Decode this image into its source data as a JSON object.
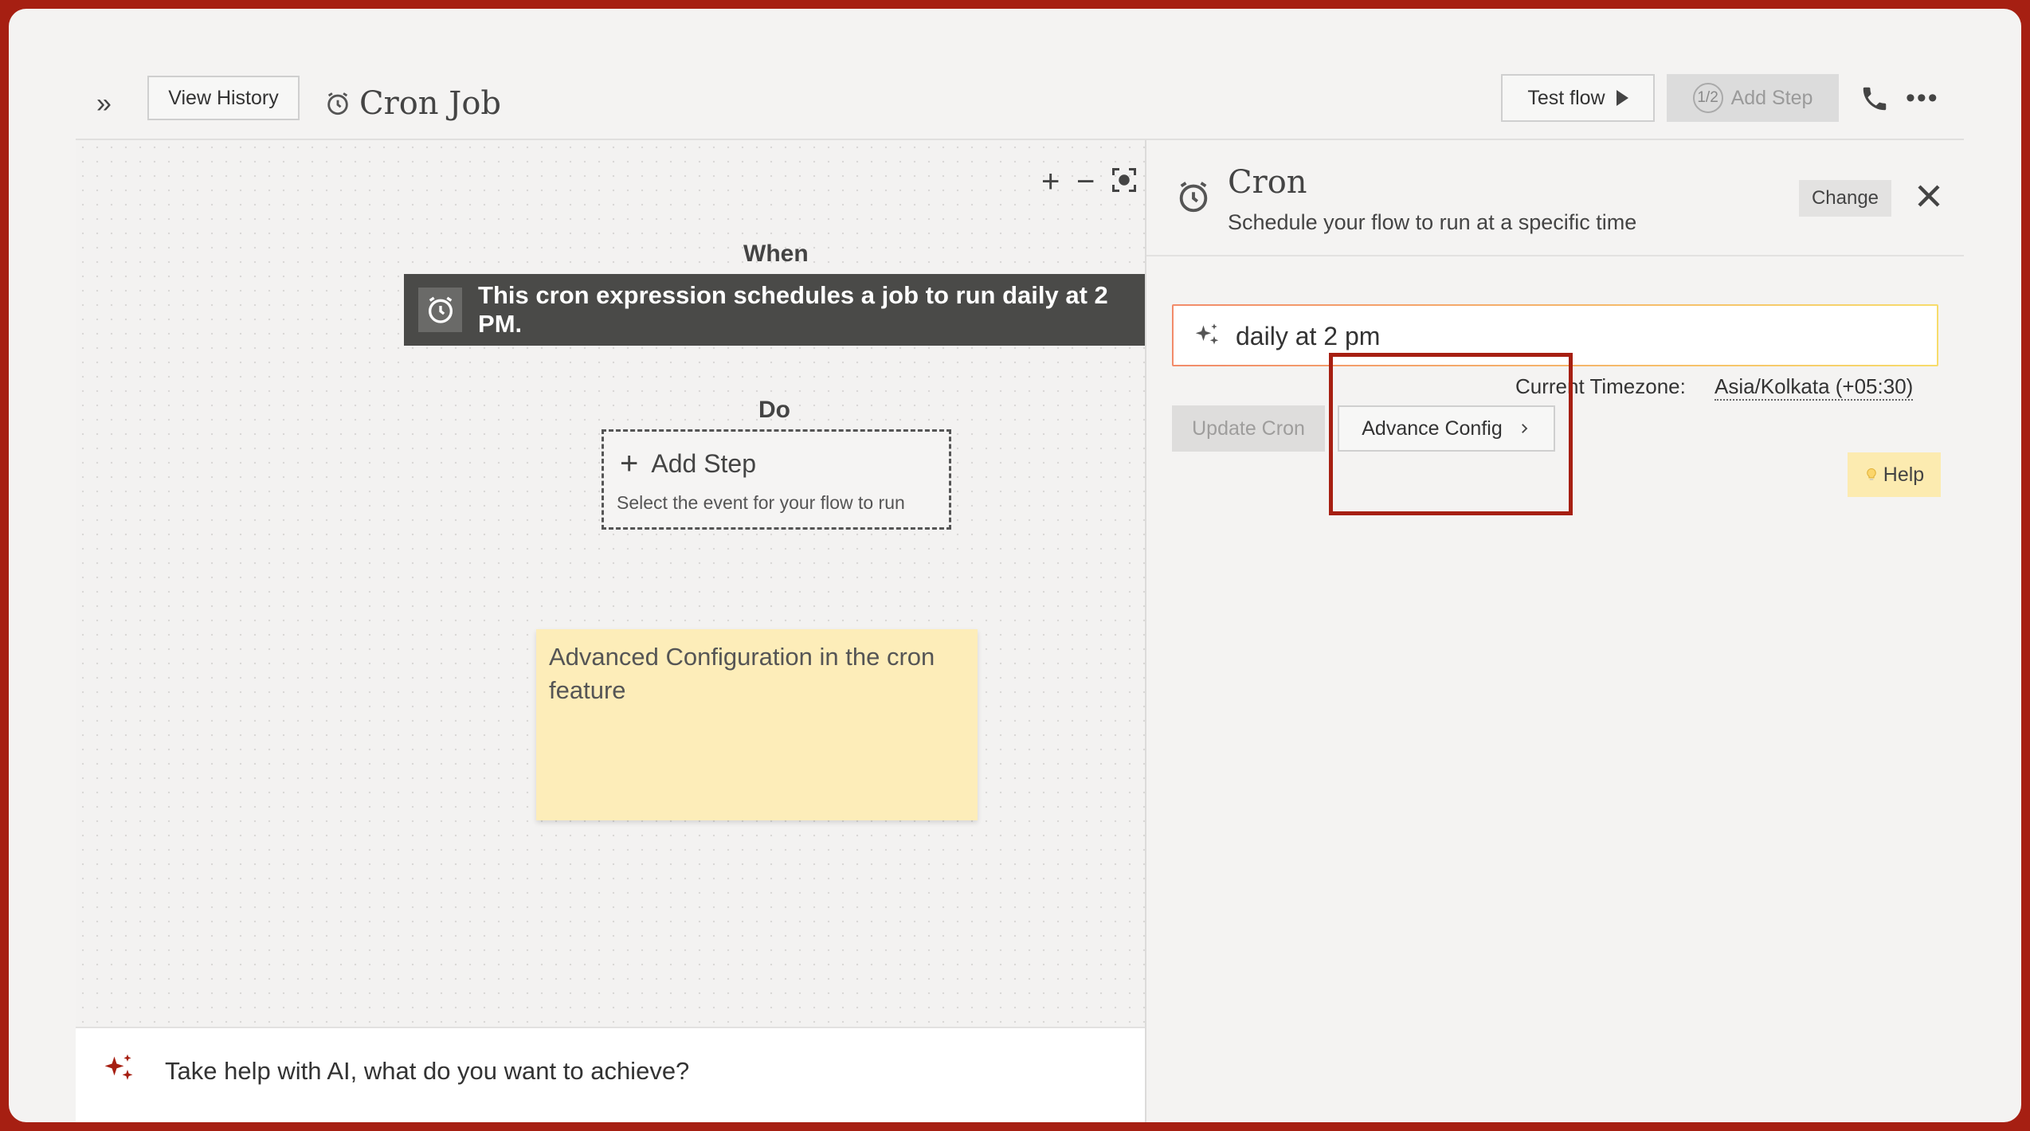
{
  "header": {
    "expand_glyph": "»",
    "view_history_label": "View History",
    "title": "Cron Job",
    "test_flow_label": "Test flow",
    "step_badge": "1/2",
    "add_step_label": "Add Step",
    "more_glyph": "•••"
  },
  "canvas": {
    "zoom_in": "+",
    "zoom_out": "−",
    "when_label": "When",
    "trigger_text": "This cron expression schedules a job to run daily at 2 PM.",
    "do_label": "Do",
    "add_step_title": "Add Step",
    "add_step_subtitle": "Select the event for your flow to run",
    "sticky_note": "Advanced Configuration in the cron feature",
    "ai_placeholder": "Take help with AI, what do you want to achieve?"
  },
  "panel": {
    "title": "Cron",
    "subtitle": "Schedule your flow to run at a specific time",
    "change_label": "Change",
    "cron_input_value": "daily at 2 pm",
    "timezone_label": "Current Timezone:",
    "timezone_value": "Asia/Kolkata (+05:30)",
    "update_cron_label": "Update Cron",
    "advance_config_label": "Advance Config",
    "help_label": "Help"
  },
  "icons": {
    "title": "alarm-clock-icon",
    "trigger": "alarm-clock-icon",
    "panel": "alarm-clock-icon",
    "phone": "phone-icon",
    "ai": "sparkle-icon",
    "close": "close-icon",
    "fit": "fit-screen-icon"
  },
  "colors": {
    "frame_border": "#a61f12",
    "trigger_card": "#4a4a48",
    "sticky_note": "#fdedb9",
    "help_button": "#fcebb0",
    "highlight": "#a61f12"
  }
}
